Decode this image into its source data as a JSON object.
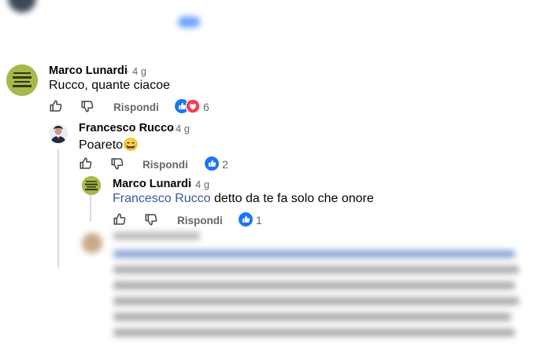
{
  "colors": {
    "like_blue": "#1877f2",
    "love_red": "#f33e58",
    "meta_gray": "#65676b",
    "mention_blue": "#385898",
    "thread_line": "#d8dadf"
  },
  "comments": [
    {
      "author": "Marco Lunardi",
      "time": "· 4 g",
      "text": "Rucco, quante ciacoe",
      "reply_label": "Rispondi",
      "reactions": [
        "like",
        "love"
      ],
      "reaction_count": "6",
      "avatar_text": "NON SONO PELATO LUCIDO"
    },
    {
      "author": "Francesco Rucco",
      "time": "· 4 g",
      "text": "Poareto😄",
      "reply_label": "Rispondi",
      "reactions": [
        "like"
      ],
      "reaction_count": "2"
    },
    {
      "author": "Marco Lunardi",
      "time": "· 4 g",
      "mention": "Francesco Rucco",
      "text": "detto da te fa solo che onore",
      "reply_label": "Rispondi",
      "reactions": [
        "like"
      ],
      "reaction_count": "1"
    }
  ]
}
